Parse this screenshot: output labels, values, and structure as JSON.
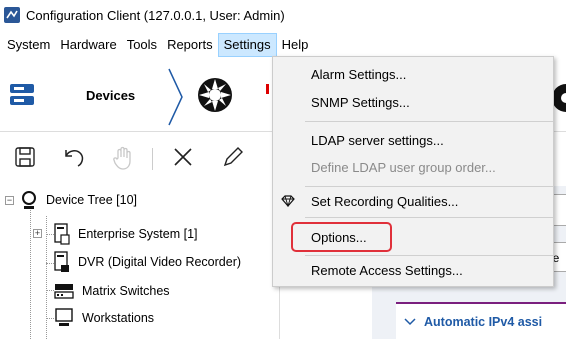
{
  "window": {
    "title": "Configuration Client (127.0.0.1, User: Admin)"
  },
  "menubar": {
    "items": [
      {
        "label": "System"
      },
      {
        "label": "Hardware"
      },
      {
        "label": "Tools"
      },
      {
        "label": "Reports"
      },
      {
        "label": "Settings"
      },
      {
        "label": "Help"
      }
    ]
  },
  "banner": {
    "devices_label": "Devices"
  },
  "tree": {
    "root": "Device Tree [10]",
    "items": [
      {
        "label": "Enterprise System [1]"
      },
      {
        "label": "DVR (Digital Video Recorder)"
      },
      {
        "label": "Matrix Switches"
      },
      {
        "label": "Workstations"
      }
    ]
  },
  "settings_menu": {
    "items": [
      {
        "label": "Alarm Settings..."
      },
      {
        "label": "SNMP Settings..."
      },
      {
        "label": "LDAP server settings..."
      },
      {
        "label": "Define LDAP user group order..."
      },
      {
        "label": "Set Recording Qualities..."
      },
      {
        "label": "Options..."
      },
      {
        "label": "Remote Access Settings..."
      }
    ]
  },
  "right_pane": {
    "partial_1": "iv",
    "partial_2": "Ne",
    "section_header": "Automatic IPv4 assi"
  },
  "colors": {
    "highlight": "#e0303a",
    "accent_purple": "#7a1f7e",
    "link_blue": "#1f5aa6"
  }
}
